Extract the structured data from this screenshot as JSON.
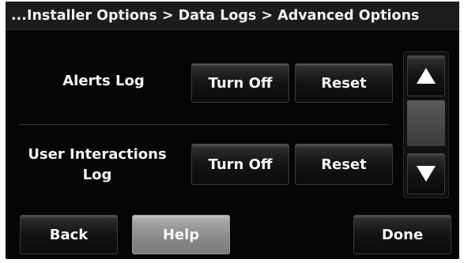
{
  "title_bar": {
    "breadcrumb": "...Installer Options > Data Logs > Advanced Options"
  },
  "rows": [
    {
      "label": "Alerts Log",
      "turn_off_label": "Turn Off",
      "reset_label": "Reset"
    },
    {
      "label": "User Interactions Log",
      "turn_off_label": "Turn Off",
      "reset_label": "Reset"
    }
  ],
  "scroll": {
    "up_icon": "triangle-up-icon",
    "down_icon": "triangle-down-icon"
  },
  "footer": {
    "back_label": "Back",
    "help_label": "Help",
    "done_label": "Done"
  },
  "colors": {
    "screen_bg": "#050505",
    "text": "#f2f2f2",
    "help_button": "#9a9a9a"
  }
}
